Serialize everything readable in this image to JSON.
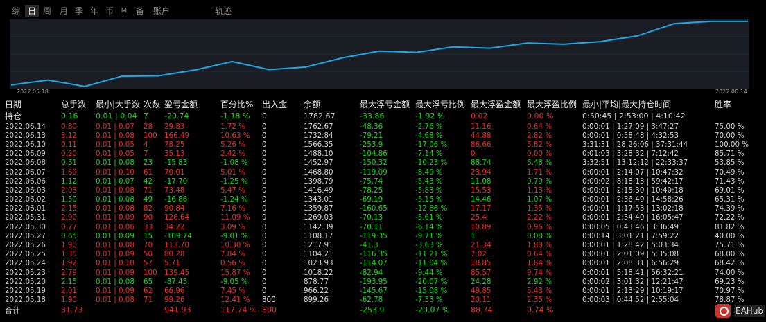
{
  "tabs": [
    {
      "label": "综",
      "active": false,
      "small": false
    },
    {
      "label": "日",
      "active": true,
      "small": false
    },
    {
      "label": "周",
      "active": false,
      "small": false
    },
    {
      "label": "月",
      "active": false,
      "small": false
    },
    {
      "label": "季",
      "active": false,
      "small": false
    },
    {
      "label": "年",
      "active": false,
      "small": false
    },
    {
      "label": "币",
      "active": false,
      "small": false
    },
    {
      "label": "M",
      "active": false,
      "small": true
    },
    {
      "label": "备",
      "active": false,
      "small": false
    },
    {
      "label": "账户",
      "active": false,
      "small": false
    },
    {
      "label": "轨迹",
      "active": false,
      "small": false
    }
  ],
  "chart": {
    "start_label": "2022.05.18",
    "end_label": "2022.06.14",
    "line_color": "#1ea7e8",
    "grid_color": "#232a33",
    "bg_color": "#1a1e24"
  },
  "chart_data": {
    "type": "line",
    "x": [
      "2022.05.18",
      "2022.05.19",
      "2022.05.20",
      "2022.05.23",
      "2022.05.24",
      "2022.05.25",
      "2022.05.26",
      "2022.05.27",
      "2022.05.30",
      "2022.05.31",
      "2022.06.01",
      "2022.06.02",
      "2022.06.03",
      "2022.06.06",
      "2022.06.07",
      "2022.06.08",
      "2022.06.09",
      "2022.06.10",
      "2022.06.13",
      "2022.06.14",
      "2022.06.14"
    ],
    "values": [
      899.26,
      966.22,
      878.77,
      1018.22,
      1023.93,
      1104.21,
      1217.91,
      1108.17,
      1142.39,
      1269.03,
      1359.87,
      1343.01,
      1416.49,
      1398.79,
      1468.8,
      1452.97,
      1488.1,
      1566.35,
      1732.84,
      1762.67,
      1762.67
    ],
    "xlabel": "",
    "ylabel": "",
    "ylim": [
      850,
      1790
    ],
    "grid": true
  },
  "table": {
    "headers": [
      "日期",
      "总手数",
      "最小|大手数",
      "次数",
      "盈亏金额",
      "百分比%",
      "出入金",
      "余额",
      "最大浮亏金额",
      "最大浮亏比例",
      "最大浮盈金额",
      "最大浮盈比例",
      "最小|平均|最大持仓时间",
      "胜率"
    ],
    "holding": [
      "持仓",
      "0.16",
      "0.01 | 0.04",
      "7",
      "-20.74",
      "-1.18 %",
      "0",
      "1762.67",
      "-33.86",
      "-1.92 %",
      "0.02",
      "0.00 %",
      "0:50:45 | 2:53:00 | 4:10:42",
      ""
    ],
    "holding_colors": [
      "neu",
      "pos",
      "pos",
      "pos",
      "pos",
      "pos",
      "neu",
      "neu",
      "pos",
      "pos",
      "neg",
      "neg",
      "neu",
      "neu"
    ],
    "rows": [
      [
        "2022.06.14",
        "0.80",
        "0.01 | 0.07",
        "28",
        "29.83",
        "1.72 %",
        "0",
        "1762.67",
        "-48.36",
        "-2.76 %",
        "11.16",
        "0.64 %",
        "0:00:01 | 1:27:09 | 3:47:27",
        "75.00 %"
      ],
      [
        "2022.06.13",
        "3.12",
        "0.01 | 0.08",
        "100",
        "166.49",
        "10.63 %",
        "0",
        "1732.84",
        "-79.21",
        "-4.68 %",
        "44.88",
        "2.82 %",
        "0:00:01 | 0:58:48 | 4:32:53",
        "70.00 %"
      ],
      [
        "2022.06.10",
        "0.11",
        "0.01 | 0.05",
        "4",
        "78.25",
        "5.26 %",
        "0",
        "1566.35",
        "-253.9",
        "-17.06 %",
        "86.66",
        "5.82 %",
        "3:31:31 | 28:26:06 | 37:31:44",
        "100.00 %"
      ],
      [
        "2022.06.09",
        "0.20",
        "0.01 | 0.05",
        "7",
        "35.13",
        "2.42 %",
        "0",
        "1488.10",
        "-104.86",
        "-7.14 %",
        "0",
        "0.00 %",
        "0:01:03 | 3:28:32 | 7:12:42",
        "85.71 %"
      ],
      [
        "2022.06.08",
        "0.51",
        "0.01 | 0.08",
        "23",
        "-15.83",
        "-1.08 %",
        "0",
        "1452.97",
        "-150.32",
        "-10.23 %",
        "88.74",
        "6.48 %",
        "3:32:51 | 13:12:12 | 22:33:37",
        "53.85 %"
      ],
      [
        "2022.06.07",
        "1.69",
        "0.01 | 0.10",
        "61",
        "70.01",
        "5.01 %",
        "0",
        "1468.80",
        "-119.09",
        "-8.49 %",
        "23.94",
        "1.71 %",
        "0:00:01 | 2:14:07 | 10:47:32",
        "70.49 %"
      ],
      [
        "2022.06.06",
        "1.12",
        "0.01 | 0.07",
        "42",
        "-17.70",
        "-1.25 %",
        "0",
        "1398.79",
        "-75.74",
        "-5.43 %",
        "11.08",
        "0.79 %",
        "0:00:02 | 8:18:13 | 59:42:17",
        "71.43 %"
      ],
      [
        "2022.06.03",
        "2.03",
        "0.01 | 0.08",
        "71",
        "73.48",
        "5.47 %",
        "0",
        "1416.49",
        "-78.25",
        "-5.83 %",
        "15.53",
        "1.13 %",
        "0:00:01 | 2:15:30 | 10:40:18",
        "69.01 %"
      ],
      [
        "2022.06.02",
        "1.50",
        "0.01 | 0.08",
        "49",
        "-16.86",
        "-1.24 %",
        "0",
        "1343.01",
        "-69.19",
        "-5.15 %",
        "14.46",
        "1.07 %",
        "0:00:01 | 2:36:49 | 14:58:26",
        "65.31 %"
      ],
      [
        "2022.06.01",
        "2.15",
        "0.01 | 0.08",
        "82",
        "90.84",
        "7.16 %",
        "0",
        "1359.87",
        "-160.65",
        "-12.66 %",
        "17.17",
        "1.35 %",
        "0:00:01 | 1:17:53 | 13:02:18",
        "74.39 %"
      ],
      [
        "2022.05.31",
        "2.90",
        "0.01 | 0.09",
        "90",
        "126.64",
        "11.09 %",
        "0",
        "1269.03",
        "-70.13",
        "-5.61 %",
        "25.4",
        "2.22 %",
        "0:00:01 | 2:34:40 | 16:05:47",
        "72.22 %"
      ],
      [
        "2022.05.30",
        "0.77",
        "0.01 | 0.06",
        "33",
        "34.22",
        "3.09 %",
        "0",
        "1142.39",
        "-70.11",
        "-6.14 %",
        "10.89",
        "0.96 %",
        "0:00:05 | 0:43:46 | 3:36:49",
        "81.82 %"
      ],
      [
        "2022.05.27",
        "0.65",
        "0.01 | 0.09",
        "15",
        "-109.74",
        "-9.01 %",
        "0",
        "1108.17",
        "-119.35",
        "-9.71 %",
        "1",
        "0.08 %",
        "0:00:14 | 3:01:21 | 7:59:22",
        "40.00 %"
      ],
      [
        "2022.05.26",
        "1.90",
        "0.01 | 0.08",
        "70",
        "113.70",
        "10.30 %",
        "0",
        "1217.91",
        "-41.3",
        "-3.63 %",
        "21.34",
        "1.88 %",
        "0:00:01 | 1:28:42 | 5:03:34",
        "75.71 %"
      ],
      [
        "2022.05.25",
        "1.35",
        "0.01 | 0.09",
        "50",
        "80.28",
        "7.84 %",
        "0",
        "1104.21",
        "-116.35",
        "-11.21 %",
        "7.02",
        "0.64 %",
        "0:00:01 | 2:01:09 | 5:35:08",
        "68.00 %"
      ],
      [
        "2022.05.24",
        "1.92",
        "0.01 | 0.10",
        "57",
        "5.71",
        "0.56 %",
        "0",
        "1023.93",
        "-114.07",
        "-11.04 %",
        "18.85",
        "1.84 %",
        "0:00:01 | 2:08:31 | 6:56:29",
        "68.42 %"
      ],
      [
        "2022.05.23",
        "2.79",
        "0.01 | 0.09",
        "100",
        "139.45",
        "15.87 %",
        "0",
        "1018.22",
        "-82.94",
        "-9.44 %",
        "85.57",
        "9.74 %",
        "0:00:01 | 5:18:41 | 56:32:21",
        "74.00 %"
      ],
      [
        "2022.05.20",
        "2.15",
        "0.01 | 0.08",
        "65",
        "-87.45",
        "-9.05 %",
        "0",
        "878.77",
        "-193.95",
        "-20.07 %",
        "24.28",
        "2.92 %",
        "0:00:02 | 3:01:32 | 12:21:47",
        "69.23 %"
      ],
      [
        "2022.05.19",
        "2.01",
        "0.01 | 0.09",
        "62",
        "66.96",
        "7.45 %",
        "0",
        "966.22",
        "-145.67",
        "-15.08 %",
        "49.85",
        "5.43 %",
        "0:00:01 | 2:13:29 | 10:19:17",
        "70.97 %"
      ],
      [
        "2022.05.18",
        "1.90",
        "0.01 | 0.08",
        "71",
        "99.26",
        "12.41 %",
        "800",
        "899.26",
        "-62.78",
        "-7.33 %",
        "20.11",
        "2.35 %",
        "0:00:03 | 0:44:52 | 2:55:04",
        "78.87 %"
      ]
    ],
    "footer": [
      "合计",
      "31.73",
      "",
      "",
      "941.93",
      "117.74 %",
      "800",
      "",
      "-253.9",
      "-20.07 %",
      "88.74",
      "9.74 %",
      "",
      ""
    ],
    "footer_colors": [
      "neu",
      "neg",
      "neu",
      "neu",
      "neg",
      "neg",
      "neg",
      "neu",
      "pos",
      "pos",
      "neg",
      "neg",
      "neu",
      "neu"
    ]
  },
  "logo": {
    "text": "EAHub"
  }
}
